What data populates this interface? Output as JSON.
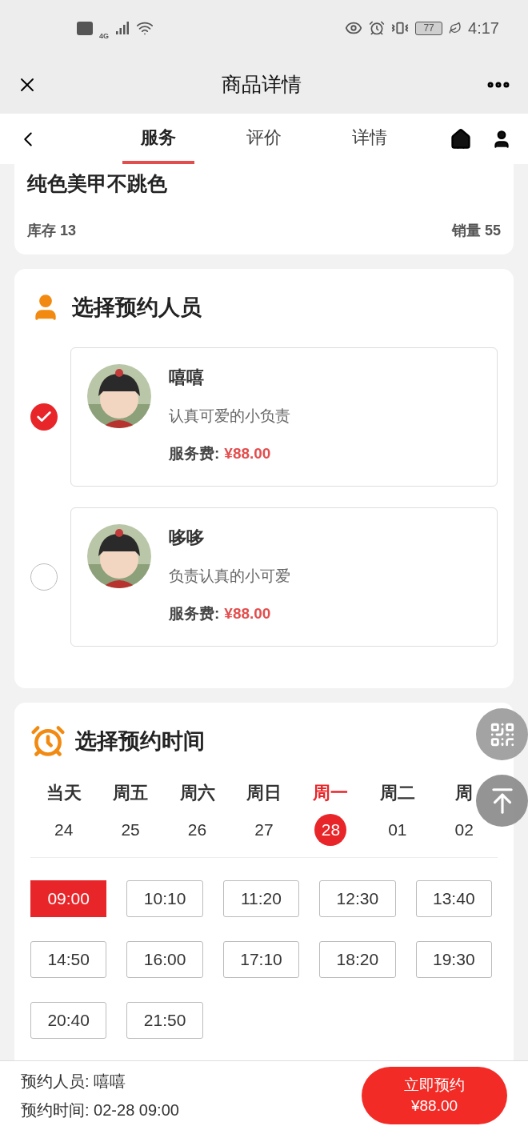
{
  "status_bar": {
    "network": "4G",
    "battery": "77",
    "time": "4:17"
  },
  "header": {
    "title": "商品详情"
  },
  "tabs": [
    {
      "label": "服务",
      "selected": true
    },
    {
      "label": "评价",
      "selected": false
    },
    {
      "label": "详情",
      "selected": false
    }
  ],
  "product": {
    "name": "纯色美甲不跳色",
    "stock": "库存 13",
    "sales": "销量 55"
  },
  "staff_section": {
    "title": "选择预约人员",
    "staff": [
      {
        "name": "嘻嘻",
        "description": "认真可爱的小负责",
        "fee_label": "服务费:",
        "fee": "¥88.00",
        "selected": true
      },
      {
        "name": "哆哆",
        "description": "负责认真的小可爱",
        "fee_label": "服务费:",
        "fee": "¥88.00",
        "selected": false
      }
    ]
  },
  "time_section": {
    "title": "选择预约时间",
    "days": [
      {
        "weekday": "当天",
        "date": "24",
        "selected": false
      },
      {
        "weekday": "周五",
        "date": "25",
        "selected": false
      },
      {
        "weekday": "周六",
        "date": "26",
        "selected": false
      },
      {
        "weekday": "周日",
        "date": "27",
        "selected": false
      },
      {
        "weekday": "周一",
        "date": "28",
        "selected": true
      },
      {
        "weekday": "周二",
        "date": "01",
        "selected": false
      },
      {
        "weekday": "周",
        "date": "02",
        "selected": false
      }
    ],
    "slots": [
      {
        "time": "09:00",
        "selected": true
      },
      {
        "time": "10:10",
        "selected": false
      },
      {
        "time": "11:20",
        "selected": false
      },
      {
        "time": "12:30",
        "selected": false
      },
      {
        "time": "13:40",
        "selected": false
      },
      {
        "time": "14:50",
        "selected": false
      },
      {
        "time": "16:00",
        "selected": false
      },
      {
        "time": "17:10",
        "selected": false
      },
      {
        "time": "18:20",
        "selected": false
      },
      {
        "time": "19:30",
        "selected": false
      },
      {
        "time": "20:40",
        "selected": false
      },
      {
        "time": "21:50",
        "selected": false
      }
    ]
  },
  "footer": {
    "staff_line": "预约人员: 嘻嘻",
    "time_line": "预约时间: 02-28 09:00",
    "button_label": "立即预约",
    "button_price": "¥88.00"
  }
}
